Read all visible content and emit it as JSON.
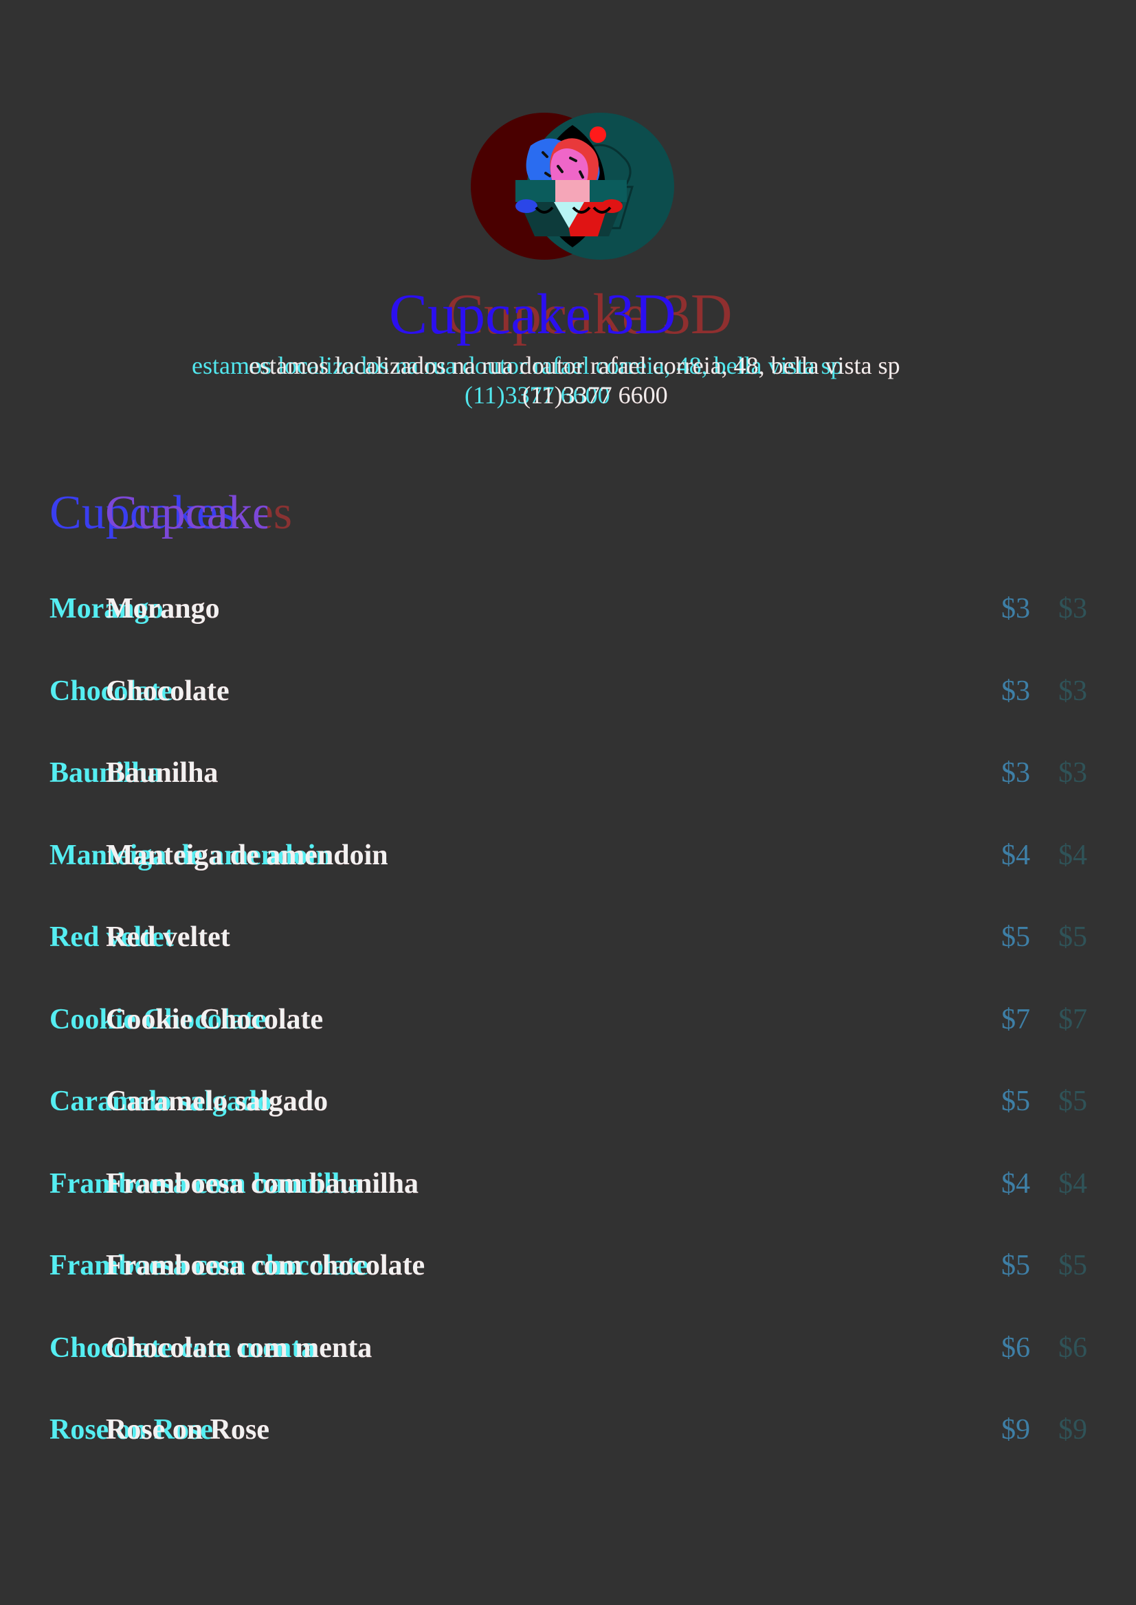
{
  "brand": {
    "title": "Cupcake 3D",
    "address": "estamos localizados na rua doutor rafael correia, 48, bella vista sp",
    "phone": "(11)3377 6600",
    "logo_icon": "cupcake-icon"
  },
  "menu": {
    "heading": "Cupcakes",
    "items": [
      {
        "name": "Morango",
        "price": "$3"
      },
      {
        "name": "Chocolate",
        "price": "$3"
      },
      {
        "name": "Baunilha",
        "price": "$3"
      },
      {
        "name": "Manteiga de amendoin",
        "price": "$4"
      },
      {
        "name": "Red veltet",
        "price": "$5"
      },
      {
        "name": "Cookie Chocolate",
        "price": "$7"
      },
      {
        "name": "Caramelo salgado",
        "price": "$5"
      },
      {
        "name": "Framboesa com baunilha",
        "price": "$4"
      },
      {
        "name": "Framboesa com chocolate",
        "price": "$5"
      },
      {
        "name": "Chocolate com menta",
        "price": "$6"
      },
      {
        "name": "Rose on Rose",
        "price": "$9"
      }
    ]
  },
  "colors": {
    "background": "#323232",
    "anaglyph_red": "#e8373a",
    "anaglyph_cyan": "#55eef2",
    "text_white": "#f1f1f1",
    "title_blue": "#2b0ff0",
    "price_blue": "#3e7fa6"
  }
}
